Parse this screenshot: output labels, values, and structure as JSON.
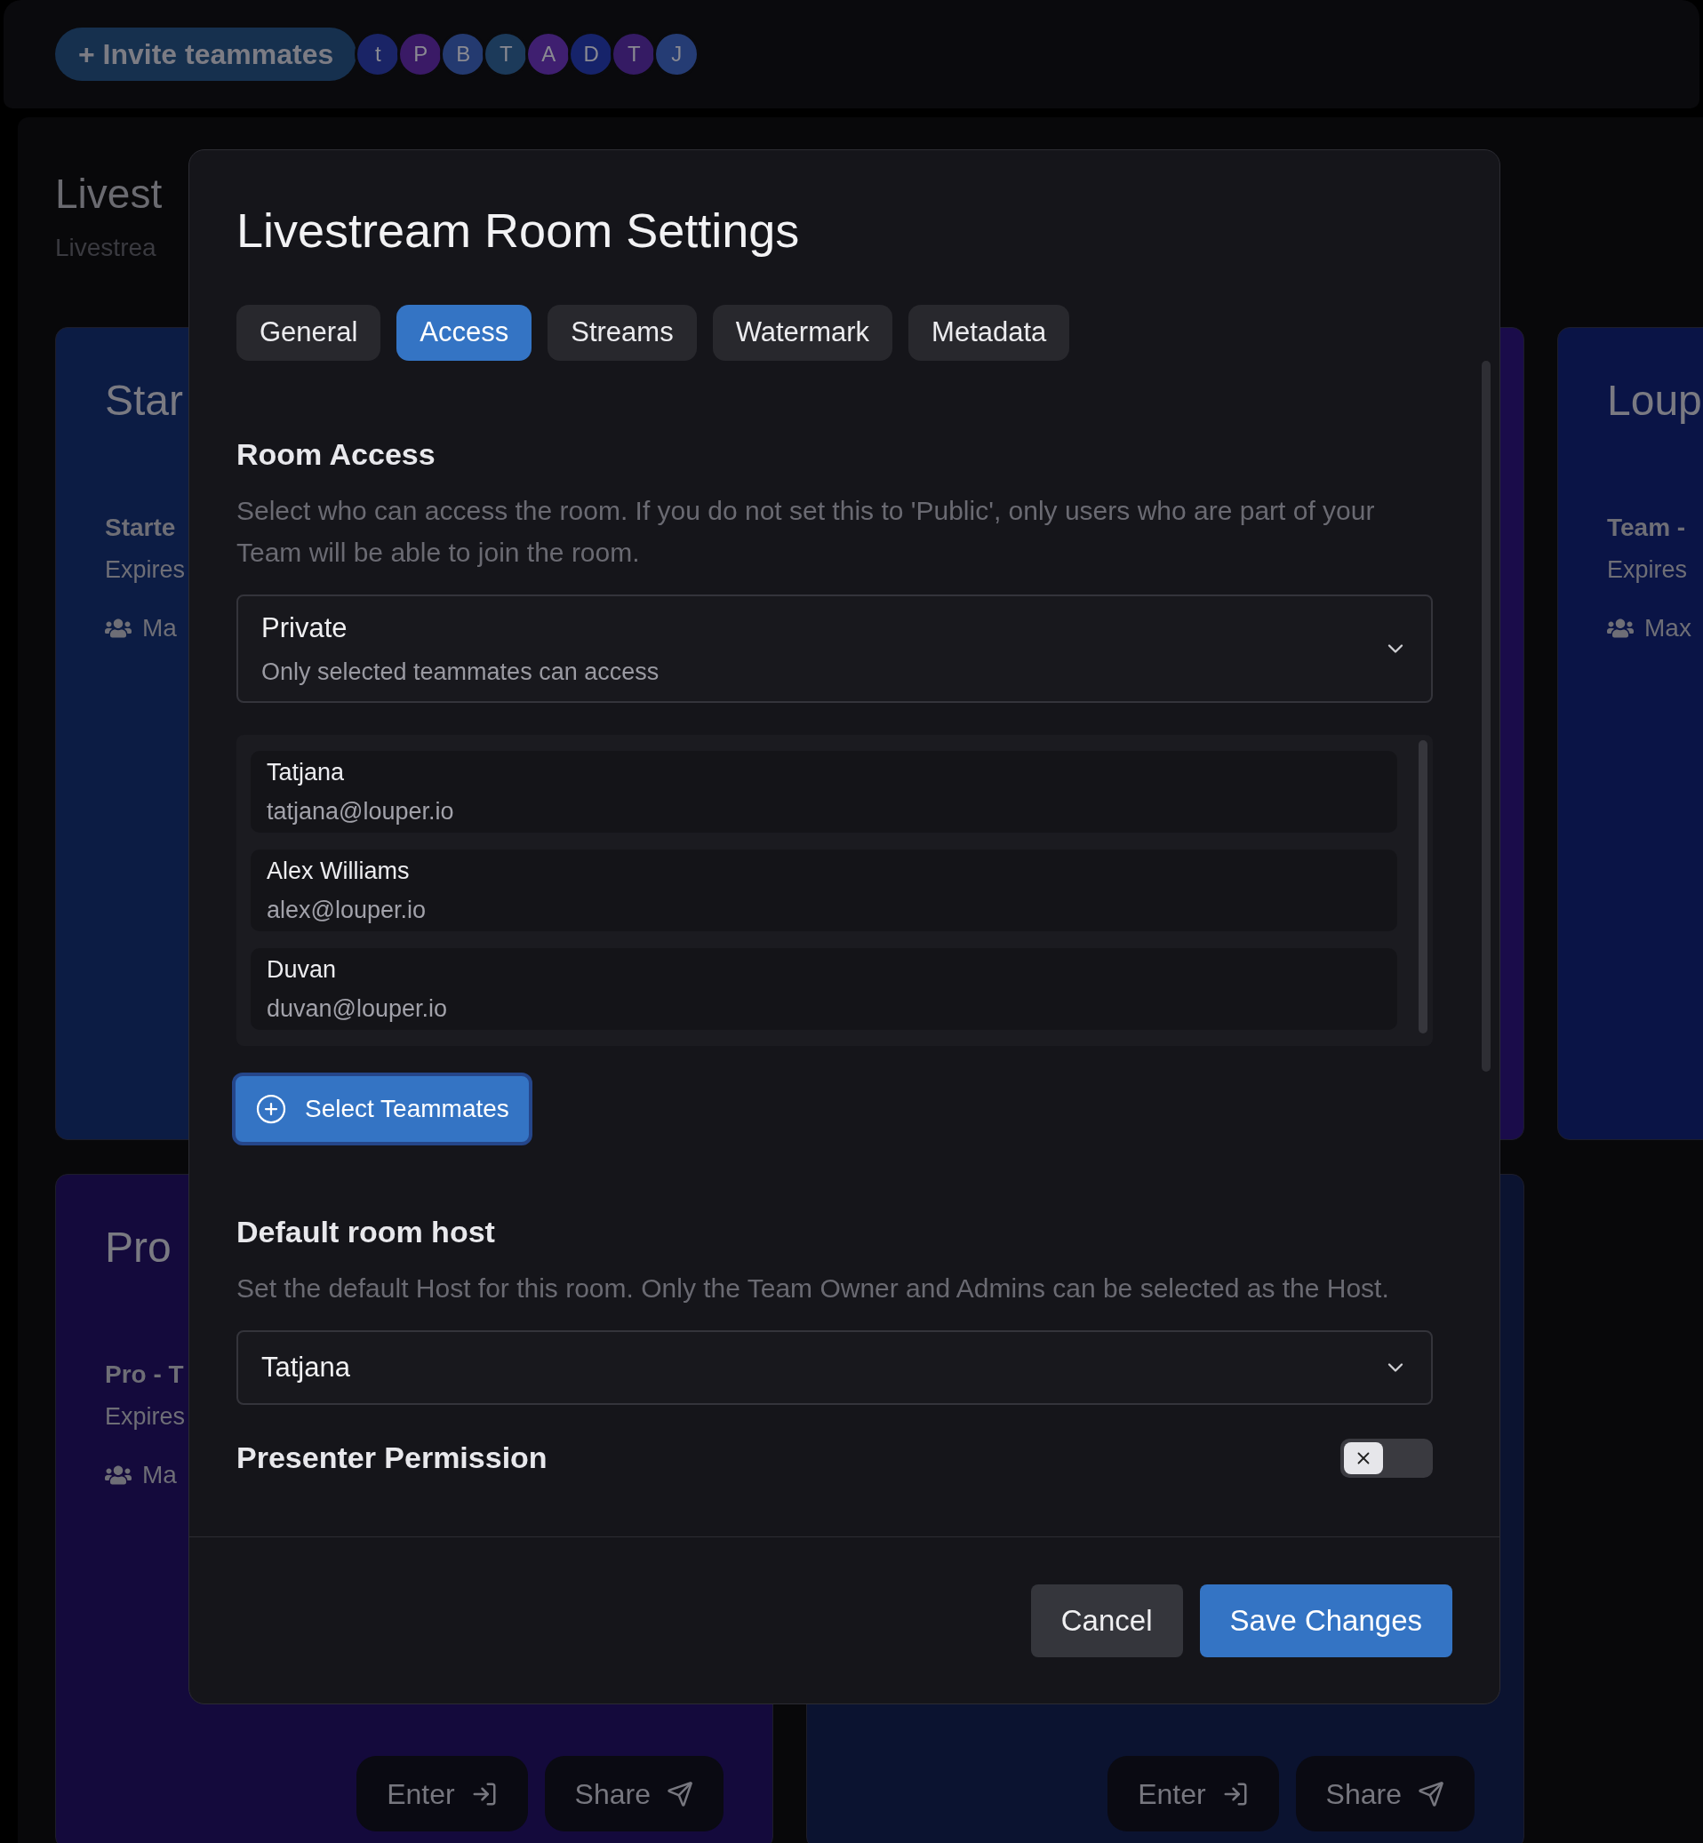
{
  "top_bar": {
    "invite_button": "+ Invite teammates",
    "avatars": [
      {
        "initial": "t",
        "color": "#1a2466"
      },
      {
        "initial": "P",
        "color": "#3a1a66"
      },
      {
        "initial": "B",
        "color": "#243a70"
      },
      {
        "initial": "T",
        "color": "#1c3a5a"
      },
      {
        "initial": "A",
        "color": "#3f1f70"
      },
      {
        "initial": "D",
        "color": "#16236a"
      },
      {
        "initial": "T",
        "color": "#351b64"
      },
      {
        "initial": "J",
        "color": "#253c74"
      }
    ]
  },
  "page": {
    "title": "Livest",
    "subtitle": "Livestrea"
  },
  "cards": [
    {
      "color": "#0c1c44",
      "title": "Star",
      "plan": "Starte",
      "expires": "Expires",
      "seats": "Ma"
    },
    {
      "color": "#1a0c4a"
    },
    {
      "color": "#0a1446",
      "title": "Loup",
      "plan": "Team -",
      "expires": "Expires",
      "seats": "Max"
    },
    {
      "color": "#140a3c",
      "title": "Pro",
      "plan": "Pro - T",
      "expires": "Expires",
      "seats": "Ma",
      "buttons": [
        {
          "kind": "enter",
          "label": "Enter"
        },
        {
          "kind": "share",
          "label": "Share"
        }
      ]
    },
    {
      "color": "#0b1330",
      "buttons": [
        {
          "kind": "enter",
          "label": "Enter"
        },
        {
          "kind": "share",
          "label": "Share"
        }
      ]
    }
  ],
  "modal": {
    "title": "Livestream Room Settings",
    "tabs": [
      {
        "label": "General",
        "selected": false
      },
      {
        "label": "Access",
        "selected": true
      },
      {
        "label": "Streams",
        "selected": false
      },
      {
        "label": "Watermark",
        "selected": false
      },
      {
        "label": "Metadata",
        "selected": false
      }
    ],
    "room_access": {
      "heading": "Room Access",
      "description": "Select who can access the room. If you do not set this to 'Public', only users who are part of your Team will be able to join the room.",
      "select": {
        "value": "Private",
        "description": "Only selected teammates can access"
      },
      "members": [
        {
          "name": "Tatjana",
          "email": "tatjana@louper.io"
        },
        {
          "name": "Alex Williams",
          "email": "alex@louper.io"
        },
        {
          "name": "Duvan",
          "email": "duvan@louper.io"
        }
      ],
      "select_button": "Select Teammates"
    },
    "default_host": {
      "heading": "Default room host",
      "description": "Set the default Host for this room. Only the Team Owner and Admins can be selected as the Host.",
      "value": "Tatjana"
    },
    "presenter_permission": {
      "heading": "Presenter Permission",
      "on": false
    },
    "footer": [
      {
        "kind": "secondary",
        "label": "Cancel"
      },
      {
        "kind": "primary",
        "label": "Save Changes"
      }
    ]
  }
}
